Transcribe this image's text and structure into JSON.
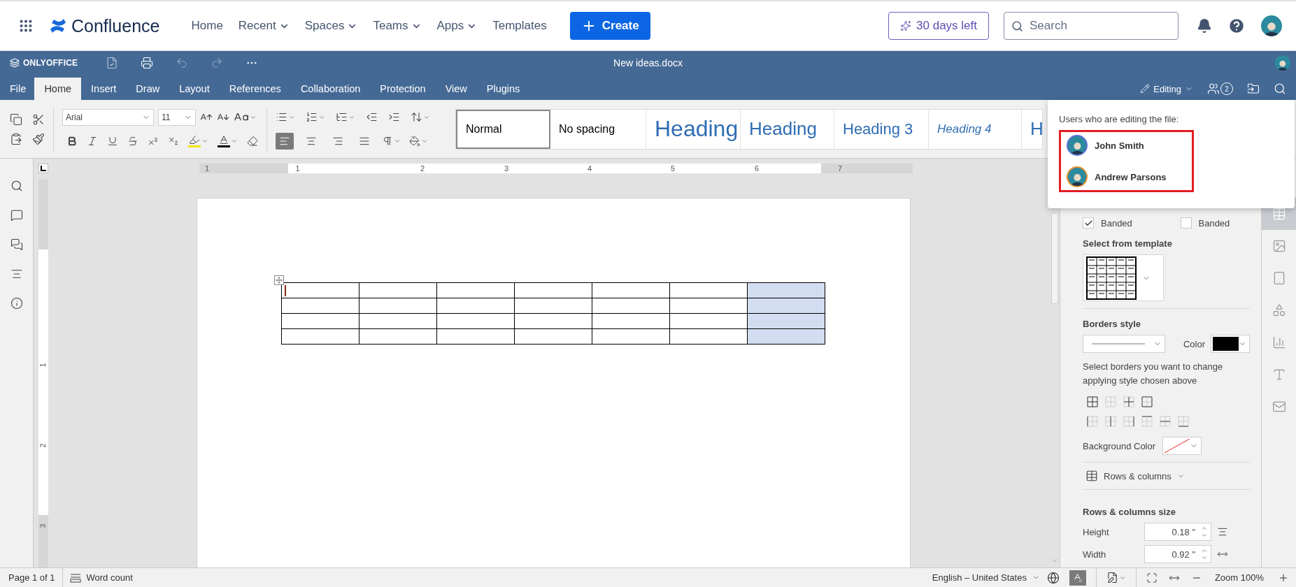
{
  "confluence": {
    "logo": "Confluence",
    "nav": [
      {
        "label": "Home",
        "dropdown": false
      },
      {
        "label": "Recent",
        "dropdown": true
      },
      {
        "label": "Spaces",
        "dropdown": true
      },
      {
        "label": "Teams",
        "dropdown": true
      },
      {
        "label": "Apps",
        "dropdown": true
      },
      {
        "label": "Templates",
        "dropdown": false
      }
    ],
    "create": "Create",
    "trial": "30 days left",
    "search": {
      "placeholder": "Search"
    }
  },
  "editor": {
    "brand": "ONLYOFFICE",
    "title": "New ideas.docx",
    "menu_tabs": [
      {
        "label": "File",
        "selected": false
      },
      {
        "label": "Home",
        "selected": true
      },
      {
        "label": "Insert",
        "selected": false
      },
      {
        "label": "Draw",
        "selected": false
      },
      {
        "label": "Layout",
        "selected": false
      },
      {
        "label": "References",
        "selected": false
      },
      {
        "label": "Collaboration",
        "selected": false
      },
      {
        "label": "Protection",
        "selected": false
      },
      {
        "label": "View",
        "selected": false
      },
      {
        "label": "Plugins",
        "selected": false
      }
    ],
    "mode": "Editing",
    "users_count": "2"
  },
  "toolbar": {
    "font": "Arial",
    "size": "11",
    "alignment": [
      {
        "kind": "left",
        "selected": true
      },
      {
        "kind": "center",
        "selected": false
      },
      {
        "kind": "right",
        "selected": false
      },
      {
        "kind": "justify",
        "selected": false
      }
    ],
    "styles": [
      {
        "label": "Normal",
        "kind": "normal",
        "selected": true
      },
      {
        "label": "No spacing",
        "kind": "normal",
        "selected": false
      },
      {
        "label": "Heading",
        "kind": "h1",
        "selected": false
      },
      {
        "label": "Heading",
        "kind": "h2",
        "selected": false
      },
      {
        "label": "Heading 3",
        "kind": "h3",
        "selected": false
      },
      {
        "label": "Heading 4",
        "kind": "h4",
        "selected": false
      },
      {
        "label": "H",
        "kind": "h2",
        "selected": false
      }
    ]
  },
  "ruler": {
    "labels": [
      "1",
      "1",
      "2",
      "3",
      "4",
      "5",
      "6",
      "7"
    ],
    "vertical_labels": [
      "1",
      "2",
      "3"
    ]
  },
  "table": {
    "rows": [
      {
        "cells": [
          {
            "selected": false
          },
          {
            "selected": false
          },
          {
            "selected": false
          },
          {
            "selected": false
          },
          {
            "selected": false
          },
          {
            "selected": false
          },
          {
            "selected": true
          }
        ]
      },
      {
        "cells": [
          {
            "selected": false
          },
          {
            "selected": false
          },
          {
            "selected": false
          },
          {
            "selected": false
          },
          {
            "selected": false
          },
          {
            "selected": false
          },
          {
            "selected": true
          }
        ]
      },
      {
        "cells": [
          {
            "selected": false
          },
          {
            "selected": false
          },
          {
            "selected": false
          },
          {
            "selected": false
          },
          {
            "selected": false
          },
          {
            "selected": false
          },
          {
            "selected": true
          }
        ]
      },
      {
        "cells": [
          {
            "selected": false
          },
          {
            "selected": false
          },
          {
            "selected": false
          },
          {
            "selected": false
          },
          {
            "selected": false
          },
          {
            "selected": false
          },
          {
            "selected": true
          }
        ]
      }
    ]
  },
  "popup": {
    "title": "Users who are editing the file:",
    "users": [
      {
        "name": "John Smith",
        "color": "#5b6fd6"
      },
      {
        "name": "Andrew Parsons",
        "color": "#e8912d"
      }
    ]
  },
  "panel": {
    "checkboxes": [
      {
        "label": "Banded",
        "checked": true
      },
      {
        "label": "Banded",
        "checked": false
      }
    ],
    "template_heading": "Select from template",
    "borders_heading": "Borders style",
    "color_label": "Color",
    "borders_hint": "Select borders you want to change applying style chosen above",
    "background_label": "Background Color",
    "rows_columns": "Rows & columns",
    "size_heading": "Rows & columns size",
    "height_label": "Height",
    "height_value": "0.18 \"",
    "width_label": "Width",
    "width_value": "0.92 \""
  },
  "side_tabs": [
    {
      "kind": "table",
      "selected": true
    },
    {
      "kind": "image",
      "selected": false
    },
    {
      "kind": "header",
      "selected": false
    },
    {
      "kind": "shape",
      "selected": false
    },
    {
      "kind": "chart",
      "selected": false
    },
    {
      "kind": "textart",
      "selected": false
    },
    {
      "kind": "mailmerge",
      "selected": false
    }
  ],
  "status": {
    "page": "Page 1 of 1",
    "word_count": "Word count",
    "language": "English – United States",
    "spellcheck_on": true,
    "zoom": "Zoom 100%"
  }
}
